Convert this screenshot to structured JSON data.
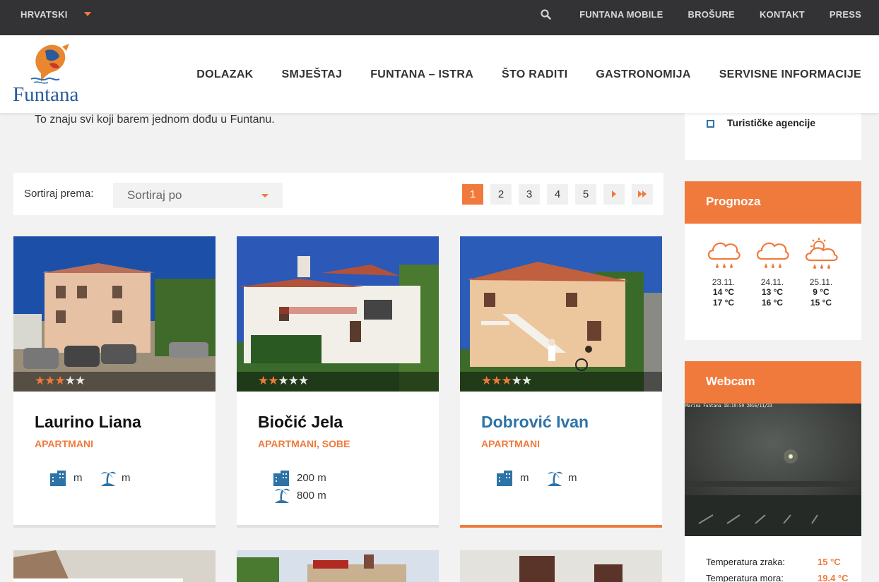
{
  "topbar": {
    "language": "HRVATSKI",
    "links": [
      "FUNTANA MOBILE",
      "BROŠURE",
      "KONTAKT",
      "PRESS"
    ]
  },
  "header": {
    "logo_text": "Funtana",
    "nav": [
      "DOLAZAK",
      "SMJEŠTAJ",
      "FUNTANA – ISTRA",
      "ŠTO RADITI",
      "GASTRONOMIJA",
      "SERVISNE INFORMACIJE"
    ]
  },
  "intro_text": "To znaju svi koji barem jednom dođu u Funtanu.",
  "sort": {
    "label": "Sortiraj prema:",
    "selected": "Sortiraj po"
  },
  "pagination": {
    "pages": [
      "1",
      "2",
      "3",
      "4",
      "5"
    ],
    "current": "1"
  },
  "listings": [
    {
      "name": "Laurino Liana",
      "type": "APARTMANI",
      "stars": 3,
      "center": "m",
      "beach": "m"
    },
    {
      "name": "Biočić Jela",
      "type": "APARTMANI, SOBE",
      "stars": 2,
      "center": "200 m",
      "beach": "800 m"
    },
    {
      "name": "Dobrović Ivan",
      "type": "APARTMANI",
      "stars": 3,
      "center": "m",
      "beach": "m"
    }
  ],
  "sidebar": {
    "filter_label": "Turističke agencije",
    "forecast_title": "Prognoza",
    "forecast": [
      {
        "date": "23.11.",
        "min": "14 °C",
        "max": "17 °C",
        "icon": "rain-cloud-icon"
      },
      {
        "date": "24.11.",
        "min": "13 °C",
        "max": "16 °C",
        "icon": "rain-cloud-icon"
      },
      {
        "date": "25.11.",
        "min": "9 °C",
        "max": "15 °C",
        "icon": "sun-rain-cloud-icon"
      }
    ],
    "webcam_title": "Webcam",
    "webcam_stamp": "Marina Funtana 18:19:59 2016/11/23",
    "air_temp_label": "Temperatura zraka:",
    "air_temp": "15 °C",
    "sea_temp_label": "Temperatura mora:",
    "sea_temp": "19.4 °C"
  },
  "colors": {
    "accent": "#f07a3c",
    "link": "#2d73a8",
    "topbar": "#333336"
  }
}
